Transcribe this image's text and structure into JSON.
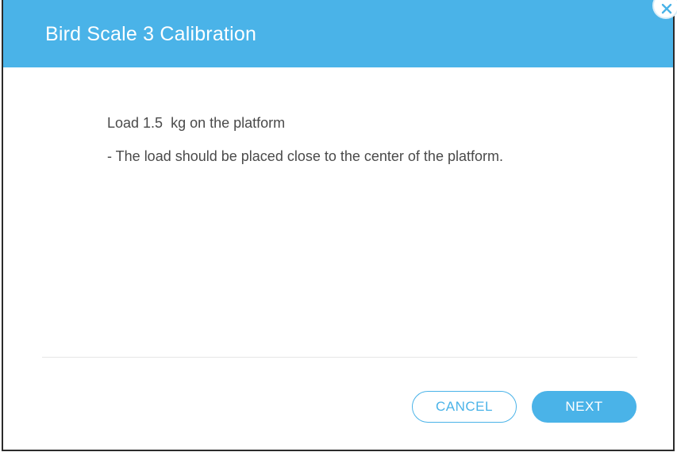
{
  "dialog": {
    "title": "Bird Scale 3 Calibration",
    "instruction": "Load 1.5  kg on the platform",
    "note": "- The load should be placed close to the center of the platform.",
    "cancel_label": "CANCEL",
    "next_label": "NEXT",
    "close_icon": "close-icon"
  },
  "colors": {
    "accent": "#4ab3e8",
    "text": "#4a4a4a",
    "header_text": "#ffffff"
  }
}
